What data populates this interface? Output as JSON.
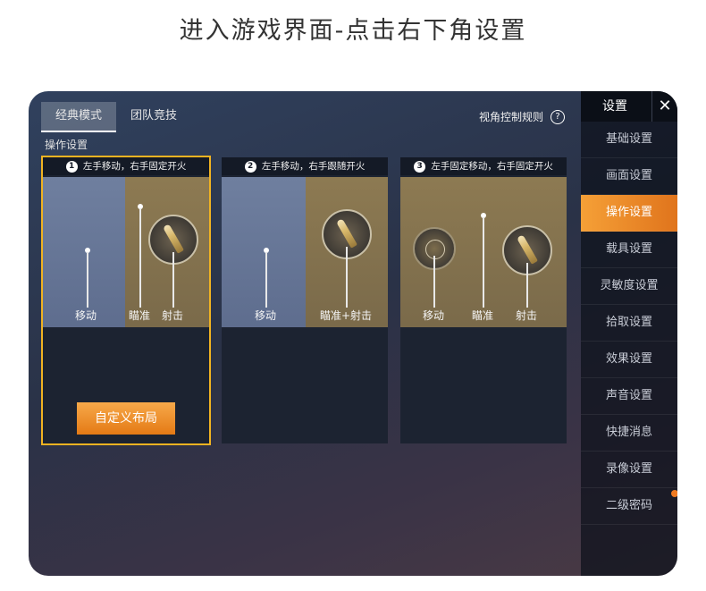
{
  "heading": "进入游戏界面-点击右下角设置",
  "tabs": [
    {
      "label": "经典模式",
      "active": true
    },
    {
      "label": "团队竞技",
      "active": false
    }
  ],
  "rules_link": "视角控制规则",
  "help_glyph": "?",
  "section_title": "操作设置",
  "cards": [
    {
      "number": "1",
      "title": "左手移动，右手固定开火",
      "selected": true,
      "labels": [
        "移动",
        "瞄准",
        "射击"
      ],
      "button": "自定义布局"
    },
    {
      "number": "2",
      "title": "左手移动，右手跟随开火",
      "selected": false,
      "labels": [
        "移动",
        "瞄准+射击"
      ]
    },
    {
      "number": "3",
      "title": "左手固定移动，右手固定开火",
      "selected": false,
      "labels": [
        "移动",
        "瞄准",
        "射击"
      ]
    }
  ],
  "sidebar": {
    "title": "设置",
    "close": "✕",
    "items": [
      {
        "label": "基础设置"
      },
      {
        "label": "画面设置"
      },
      {
        "label": "操作设置",
        "active": true
      },
      {
        "label": "载具设置"
      },
      {
        "label": "灵敏度设置"
      },
      {
        "label": "拾取设置"
      },
      {
        "label": "效果设置"
      },
      {
        "label": "声音设置"
      },
      {
        "label": "快捷消息"
      },
      {
        "label": "录像设置"
      },
      {
        "label": "二级密码"
      }
    ]
  },
  "colors": {
    "accent": "#f1b321",
    "active_item": "#f08a28",
    "zone_blue": "#6f7f9f",
    "zone_gold": "#8d7a52"
  }
}
